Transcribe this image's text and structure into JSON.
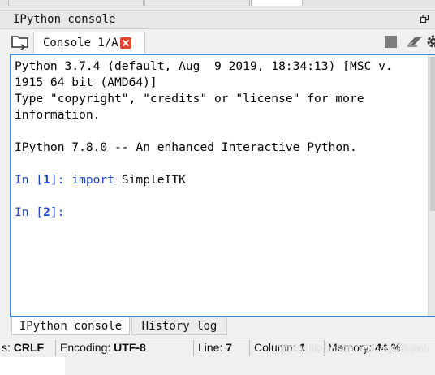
{
  "pane": {
    "title": "IPython console"
  },
  "console_tab": {
    "label": "Console 1/A"
  },
  "console": {
    "lines": {
      "l1": "Python 3.7.4 (default, Aug  9 2019, 18:34:13) [MSC v.",
      "l2": "1915 64 bit (AMD64)]",
      "l3": "Type \"copyright\", \"credits\" or \"license\" for more",
      "l4": "information.",
      "l5": "IPython 7.8.0 -- An enhanced Interactive Python."
    },
    "prompt1": {
      "in": "In [",
      "num": "1",
      "close": "]:",
      "keyword": "import",
      "code": " SimpleITK"
    },
    "prompt2": {
      "in": "In [",
      "num": "2",
      "close": "]:"
    }
  },
  "bottom_tabs": {
    "active": "IPython console",
    "inactive": "History log"
  },
  "status": {
    "eol_label": "s:",
    "eol_value": "CRLF",
    "encoding_label": "Encoding:",
    "encoding_value": "UTF-8",
    "line_label": "Line:",
    "line_value": "7",
    "column_label": "Column:",
    "column_value": "1",
    "memory_label": "Memory:",
    "memory_value": "44 %",
    "watermark": "https://blog.csdn.net/haiguijiujian"
  },
  "icons": {
    "undock": "undock-icon",
    "folder": "open-folder-icon",
    "close": "close-tab-icon",
    "stop": "stop-icon",
    "eraser": "eraser-icon",
    "gear": "gear-icon"
  },
  "colors": {
    "accent_border": "#3c87cf",
    "prompt_blue": "#1f44c7",
    "close_red": "#e2442f"
  }
}
